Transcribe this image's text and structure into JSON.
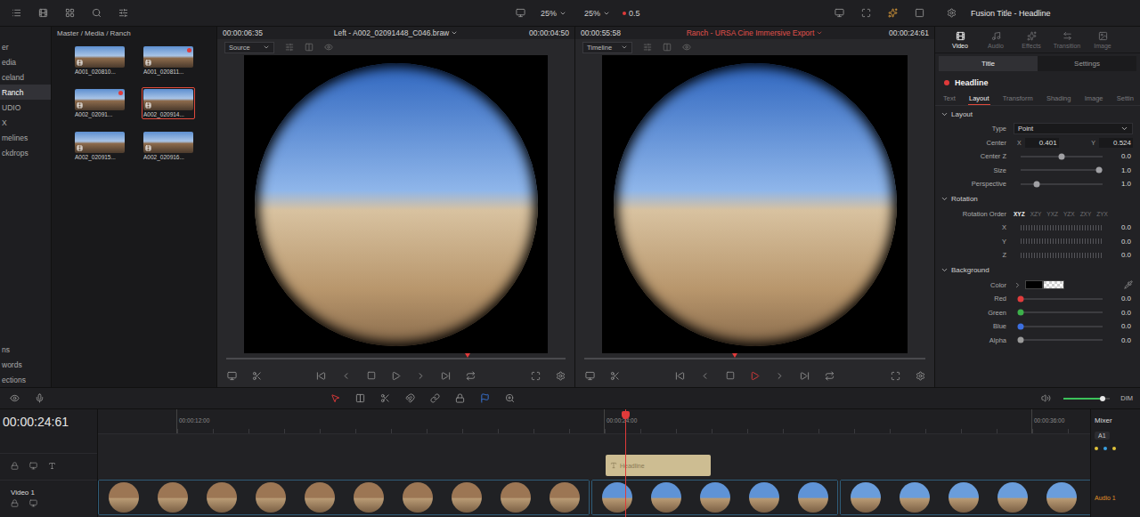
{
  "topbar": {
    "source_zoom": "25%",
    "timeline_zoom": "25%",
    "speed": "0.5",
    "panel_title": "Fusion Title - Headline"
  },
  "sidebar": {
    "items": [
      {
        "label": "er",
        "selected": false
      },
      {
        "label": "edia",
        "selected": false
      },
      {
        "label": "celand",
        "selected": false
      },
      {
        "label": "Ranch",
        "selected": true
      },
      {
        "label": "UDIO",
        "selected": false
      },
      {
        "label": "X",
        "selected": false
      },
      {
        "label": "melines",
        "selected": false
      },
      {
        "label": "ckdrops",
        "selected": false
      }
    ],
    "lower_items": [
      {
        "label": "ns",
        "selected": false
      },
      {
        "label": "words",
        "selected": false
      },
      {
        "label": "ections",
        "selected": false
      }
    ]
  },
  "media_pool": {
    "path": "Master / Media / Ranch",
    "clips": [
      {
        "name": "A001_020810...",
        "flagged": false,
        "selected": false
      },
      {
        "name": "A001_020811...",
        "flagged": true,
        "selected": false
      },
      {
        "name": "A002_02091...",
        "flagged": true,
        "selected": false
      },
      {
        "name": "A002_020914...",
        "flagged": false,
        "selected": true
      },
      {
        "name": "A002_020915...",
        "flagged": false,
        "selected": false
      },
      {
        "name": "A002_020916...",
        "flagged": false,
        "selected": false
      }
    ]
  },
  "viewers": [
    {
      "timecode_left": "00:00:06:35",
      "title": "Left - A002_02091448_C046.braw",
      "timecode_right": "00:00:04:50",
      "mode": "Source",
      "level": 0.71,
      "playing": false,
      "color": "#d4d4d4"
    },
    {
      "timecode_left": "00:00:55:58",
      "title": "Ranch - URSA Cine Immersive Export",
      "timecode_right": "00:00:24:61",
      "mode": "Timeline",
      "level": 0.44,
      "playing": true,
      "color": "#e0504a"
    }
  ],
  "inspector": {
    "tabs": [
      {
        "label": "Video",
        "selected": true
      },
      {
        "label": "Audio",
        "selected": false
      },
      {
        "label": "Effects",
        "selected": false
      },
      {
        "label": "Transition",
        "selected": false
      },
      {
        "label": "Image",
        "selected": false
      }
    ],
    "subtabs": [
      {
        "label": "Title",
        "selected": true
      },
      {
        "label": "Settings",
        "selected": false
      }
    ],
    "node": {
      "name": "Headline"
    },
    "section_tabs": [
      {
        "label": "Text",
        "selected": false
      },
      {
        "label": "Layout",
        "selected": true
      },
      {
        "label": "Transform",
        "selected": false
      },
      {
        "label": "Shading",
        "selected": false
      },
      {
        "label": "Image",
        "selected": false
      },
      {
        "label": "Settin",
        "selected": false
      }
    ],
    "sections": [
      {
        "title": "Layout",
        "expanded": true,
        "rows": [
          {
            "kind": "dropdown",
            "label": "Type",
            "value": "Point"
          },
          {
            "kind": "xy",
            "label": "Center",
            "x_label": "X",
            "x": "0.401",
            "y_label": "Y",
            "y": "0.524"
          },
          {
            "kind": "slider",
            "label": "Center Z",
            "level": 0.5,
            "value": "0.0"
          },
          {
            "kind": "slider",
            "label": "Size",
            "level": 0.96,
            "value": "1.0"
          },
          {
            "kind": "slider",
            "label": "Perspective",
            "level": 0.2,
            "value": "1.0"
          }
        ]
      },
      {
        "title": "Rotation",
        "expanded": true,
        "rows": [
          {
            "kind": "order",
            "label": "Rotation Order",
            "options": [
              {
                "label": "XYZ",
                "selected": true
              },
              {
                "label": "XZY",
                "selected": false
              },
              {
                "label": "YXZ",
                "selected": false
              },
              {
                "label": "YZX",
                "selected": false
              },
              {
                "label": "ZXY",
                "selected": false
              },
              {
                "label": "ZYX",
                "selected": false
              }
            ]
          },
          {
            "kind": "dial",
            "label": "X",
            "value": "0.0"
          },
          {
            "kind": "dial",
            "label": "Y",
            "value": "0.0"
          },
          {
            "kind": "dial",
            "label": "Z",
            "value": "0.0"
          }
        ]
      },
      {
        "title": "Background",
        "expanded": true,
        "rows": [
          {
            "kind": "color",
            "label": "Color",
            "color": "#000000"
          },
          {
            "kind": "channel",
            "label": "Red",
            "level": 0,
            "value": "0.0",
            "color": "#e03c3c"
          },
          {
            "kind": "channel",
            "label": "Green",
            "level": 0,
            "value": "0.0",
            "color": "#3cb04a"
          },
          {
            "kind": "channel",
            "label": "Blue",
            "level": 0,
            "value": "0.0",
            "color": "#3c6fe0"
          },
          {
            "kind": "channel",
            "label": "Alpha",
            "level": 0,
            "value": "0.0",
            "color": "#9a9a9a"
          }
        ]
      }
    ]
  },
  "timeline_toolbar": {
    "volume": {
      "level": 0.85
    },
    "dim": "DIM"
  },
  "timeline": {
    "timecode": "00:00:24:61",
    "ruler": [
      "00:00:12:00",
      "00:00:24:00",
      "00:00:36:00"
    ],
    "title_track": {
      "clips": [
        {
          "label": "Headline"
        }
      ]
    },
    "video_track": {
      "name": "Video 1",
      "clips": [
        {
          "frames": 10,
          "color": "#9c7654"
        },
        {
          "frames": 5,
          "color": "#5f93d6"
        },
        {
          "frames": 6,
          "color": "#6a9ddb"
        }
      ]
    }
  },
  "mixer": {
    "title": "Mixer",
    "channel": "A1",
    "track": "Audio 1"
  }
}
